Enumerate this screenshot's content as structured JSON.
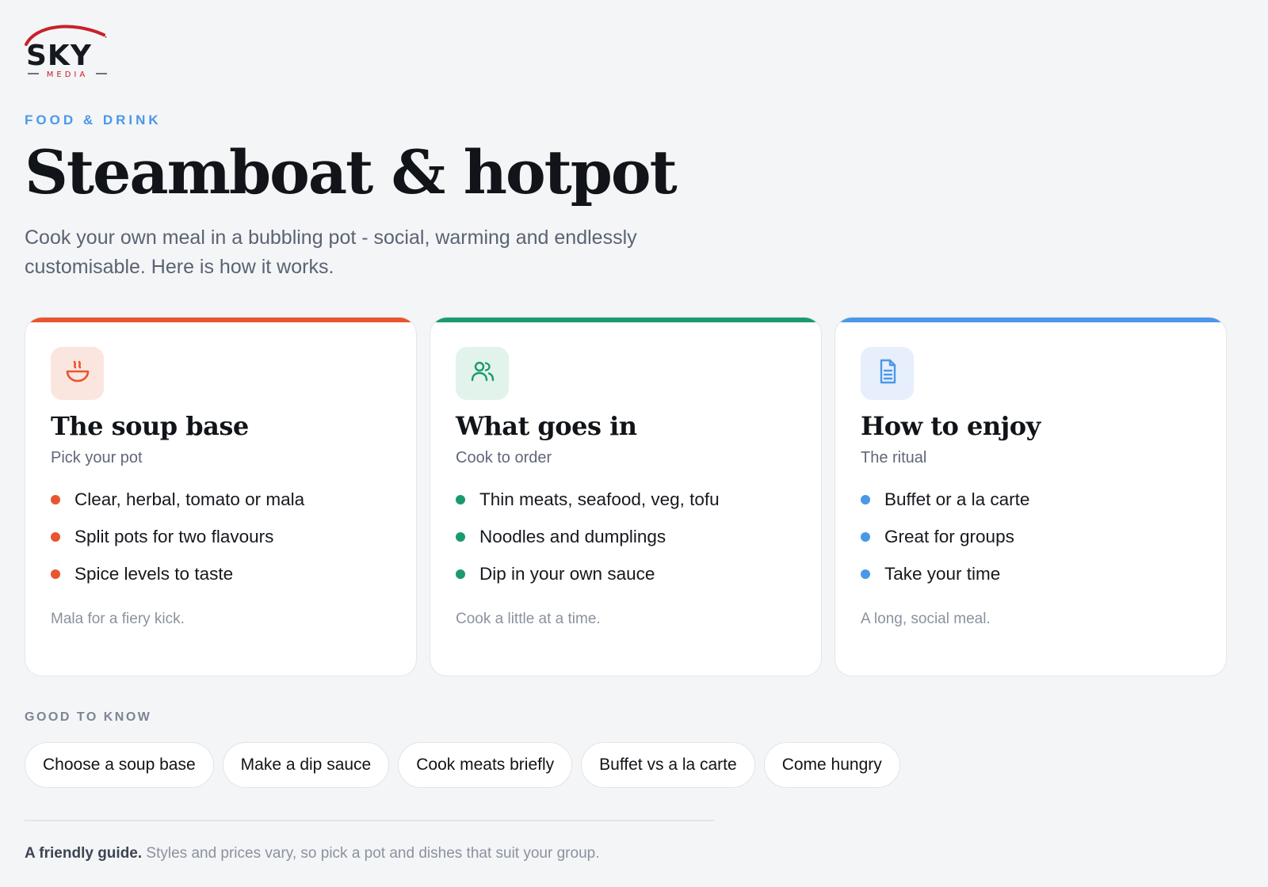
{
  "brand": {
    "logo_text": "SKY",
    "logo_subtext": "MEDIA",
    "logo_red": "#c8202a",
    "logo_dark": "#161a20"
  },
  "header": {
    "eyebrow": "FOOD & DRINK",
    "title": "Steamboat & hotpot",
    "lede": "Cook your own meal in a bubbling pot - social, warming and endlessly customisable. Here is how it works."
  },
  "cards": [
    {
      "icon": "soup-bowl-icon",
      "accent": "#e8552f",
      "tile_bg": "#fbe6df",
      "title": "The soup base",
      "subtitle": "Pick your pot",
      "items": [
        "Clear, herbal, tomato or mala",
        "Split pots for two flavours",
        "Spice levels to taste"
      ],
      "footnote": "Mala for a fiery kick."
    },
    {
      "icon": "users-icon",
      "accent": "#1b9a6c",
      "tile_bg": "#e2f3eb",
      "title": "What goes in",
      "subtitle": "Cook to order",
      "items": [
        "Thin meats, seafood, veg, tofu",
        "Noodles and dumplings",
        "Dip in your own sauce"
      ],
      "footnote": "Cook a little at a time."
    },
    {
      "icon": "document-icon",
      "accent": "#4a98e8",
      "tile_bg": "#e6effb",
      "title": "How to enjoy",
      "subtitle": "The ritual",
      "items": [
        "Buffet or a la carte",
        "Great for groups",
        "Take your time"
      ],
      "footnote": "A long, social meal."
    }
  ],
  "good_to_know": {
    "label": "GOOD TO KNOW",
    "chips": [
      "Choose a soup base",
      "Make a dip sauce",
      "Cook meats briefly",
      "Buffet vs a la carte",
      "Come hungry"
    ]
  },
  "footer": {
    "lead": "A friendly guide.",
    "text": " Styles and prices vary, so pick a pot and dishes that suit your group."
  }
}
